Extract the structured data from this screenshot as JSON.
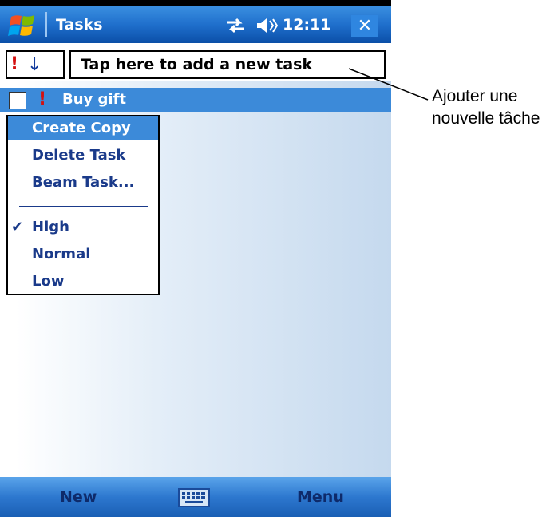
{
  "titlebar": {
    "title": "Tasks",
    "clock": "12:11",
    "close_label": "✕",
    "accent": "#1f6fcc"
  },
  "toolbar": {
    "priority_symbol": "!",
    "sort_symbol": "↓",
    "new_task_placeholder": "Tap here to add a new task"
  },
  "task": {
    "label": "Buy gift",
    "priority_symbol": "!",
    "checked": false
  },
  "context_menu": {
    "items": [
      {
        "label": "Create Copy",
        "selected": true
      },
      {
        "label": "Delete Task"
      },
      {
        "label": "Beam Task..."
      },
      {
        "label": "High",
        "checked": true
      },
      {
        "label": "Normal"
      },
      {
        "label": "Low"
      }
    ],
    "check_symbol": "✔"
  },
  "bottombar": {
    "left_label": "New",
    "right_label": "Menu"
  },
  "callout": {
    "line1": "Ajouter une",
    "line2": "nouvelle tâche"
  },
  "icons": [
    "windows-start-icon",
    "connectivity-icon",
    "volume-icon",
    "close-icon",
    "keyboard-icon",
    "checkmark-icon"
  ]
}
